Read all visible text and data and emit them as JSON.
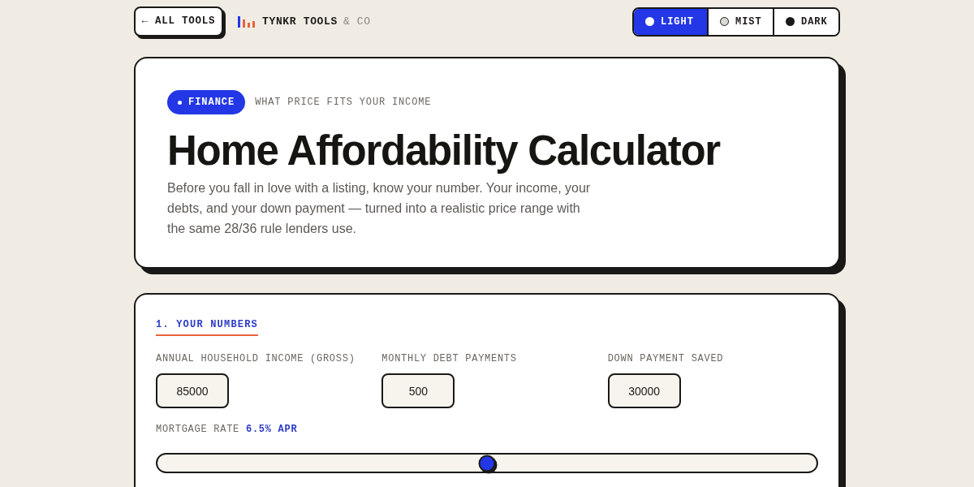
{
  "top_bar": {
    "back_button": "← ALL TOOLS",
    "brand": {
      "name": "TYNKR TOOLS",
      "suffix": "& CO"
    },
    "theme_options": [
      {
        "label": "LIGHT",
        "kind": "light",
        "selected": true
      },
      {
        "label": "MIST",
        "kind": "mist",
        "selected": false
      },
      {
        "label": "DARK",
        "kind": "dark",
        "selected": false
      }
    ]
  },
  "hero": {
    "badge": "FINANCE",
    "tagline": "WHAT PRICE FITS YOUR INCOME",
    "title": "Home Affordability Calculator",
    "description": "Before you fall in love with a listing, know your number. Your income, your debts, and your down payment — turned into a realistic price range with the same 28/36 rule lenders use."
  },
  "inputs_section": {
    "heading": "1. YOUR NUMBERS",
    "fields": [
      {
        "label": "ANNUAL HOUSEHOLD INCOME (GROSS)",
        "value": "85000"
      },
      {
        "label": "MONTHLY DEBT PAYMENTS",
        "value": "500"
      },
      {
        "label": "DOWN PAYMENT SAVED",
        "value": "30000"
      }
    ],
    "rate": {
      "label": "MORTGAGE RATE",
      "reading": "6.5% APR",
      "level": 0.5
    }
  }
}
